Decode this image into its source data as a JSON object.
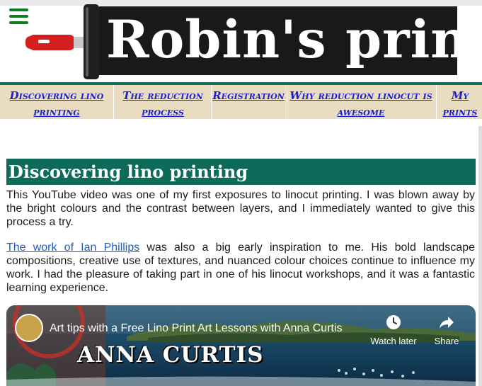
{
  "site": {
    "title": "Robin's prints"
  },
  "nav": {
    "items": [
      {
        "label": "Discovering lino printing"
      },
      {
        "label": "The reduction process"
      },
      {
        "label": "Registration"
      },
      {
        "label": "Why reduction linocut is awesome"
      },
      {
        "label": "My prints"
      }
    ]
  },
  "main": {
    "heading": "Discovering lino printing",
    "paragraph1": "This YouTube video was one of my first exposures to linocut printing. I was blown away by the bright colours and the contrast between layers, and I immediately wanted to give this process a try.",
    "paragraph2_link": "The work of Ian Phillips",
    "paragraph2_rest": " was also a big early inspiration to me. His bold landscape compositions, creative use of textures, and nuanced colour choices continue to influence my work. I had the pleasure of taking part in one of his linocut workshops, and it was a fantastic learning experience."
  },
  "video": {
    "title": "Art tips with a Free Lino Print Art Lessons with Anna Curtis",
    "channel_text": "ANNA CURTIS",
    "watch_later": "Watch later",
    "share": "Share",
    "icons": [
      "clock-icon",
      "share-arrow-icon"
    ]
  },
  "colors": {
    "nav_bg": "#eadcc0",
    "nav_link": "#1a21c8",
    "heading_bg": "#0e6b5a",
    "banner_bg": "#191919",
    "hamburger": "#0f7d23",
    "roller_red": "#d61f1f"
  }
}
